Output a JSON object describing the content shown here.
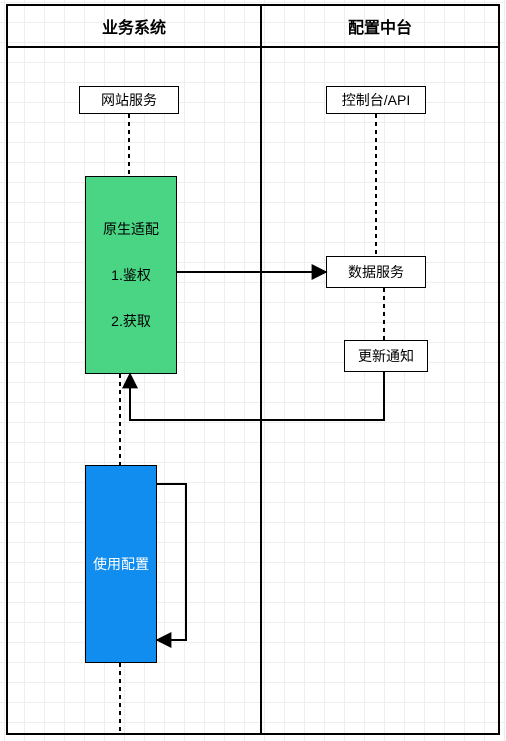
{
  "lanes": {
    "left": "业务系统",
    "right": "配置中台"
  },
  "nodes": {
    "website_service": "网站服务",
    "console_api": "控制台/API",
    "native_adapter": {
      "title": "原生适配",
      "step1": "1.鉴权",
      "step2": "2.获取"
    },
    "data_service": "数据服务",
    "update_notice": "更新通知",
    "use_config": "使用配置"
  },
  "colors": {
    "green": "#4ad585",
    "blue": "#118df0"
  },
  "chart_data": {
    "type": "diagram",
    "title": "",
    "swimlanes": [
      {
        "id": "lane_business",
        "label": "业务系统"
      },
      {
        "id": "lane_config",
        "label": "配置中台"
      }
    ],
    "nodes": [
      {
        "id": "website_service",
        "label": "网站服务",
        "lane": "lane_business",
        "shape": "rect",
        "fill": "#ffffff"
      },
      {
        "id": "console_api",
        "label": "控制台/API",
        "lane": "lane_config",
        "shape": "rect",
        "fill": "#ffffff"
      },
      {
        "id": "native_adapter",
        "label": "原生适配\\n1.鉴权\\n2.获取",
        "lane": "lane_business",
        "shape": "rect",
        "fill": "#4ad585"
      },
      {
        "id": "data_service",
        "label": "数据服务",
        "lane": "lane_config",
        "shape": "rect",
        "fill": "#ffffff"
      },
      {
        "id": "update_notice",
        "label": "更新通知",
        "lane": "lane_config",
        "shape": "rect",
        "fill": "#ffffff"
      },
      {
        "id": "use_config",
        "label": "使用配置",
        "lane": "lane_business",
        "shape": "rect",
        "fill": "#118df0"
      }
    ],
    "edges": [
      {
        "from": "website_service",
        "to": "native_adapter",
        "style": "dashed",
        "arrow": "none"
      },
      {
        "from": "console_api",
        "to": "data_service",
        "style": "dashed",
        "arrow": "none"
      },
      {
        "from": "native_adapter",
        "to": "data_service",
        "style": "solid",
        "arrow": "end"
      },
      {
        "from": "data_service",
        "to": "update_notice",
        "style": "dashed",
        "arrow": "none"
      },
      {
        "from": "update_notice",
        "to": "native_adapter",
        "style": "solid",
        "arrow": "end"
      },
      {
        "from": "native_adapter",
        "to": "use_config",
        "style": "dashed",
        "arrow": "none"
      },
      {
        "from": "use_config",
        "to": "use_config",
        "style": "solid",
        "arrow": "end",
        "self_loop": true
      },
      {
        "from": "use_config",
        "to": "lane_bottom",
        "style": "dashed",
        "arrow": "none"
      }
    ]
  }
}
